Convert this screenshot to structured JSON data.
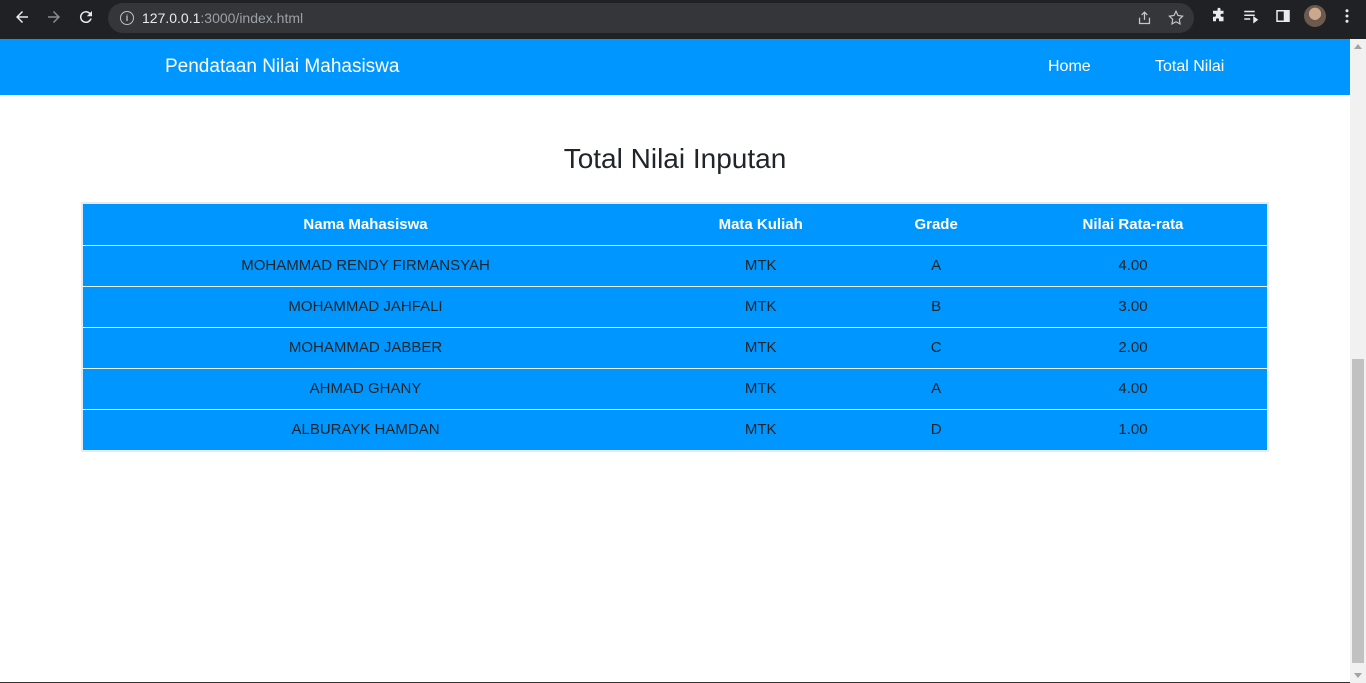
{
  "browser": {
    "url_host": "127.0.0.1",
    "url_path": ":3000/index.html"
  },
  "navbar": {
    "brand": "Pendataan Nilai Mahasiswa",
    "links": [
      "Home",
      "Total Nilai"
    ]
  },
  "main": {
    "title": "Total Nilai Inputan",
    "table": {
      "headers": [
        "Nama Mahasiswa",
        "Mata Kuliah",
        "Grade",
        "Nilai Rata-rata"
      ],
      "rows": [
        [
          "MOHAMMAD RENDY FIRMANSYAH",
          "MTK",
          "A",
          "4.00"
        ],
        [
          "MOHAMMAD JAHFALI",
          "MTK",
          "B",
          "3.00"
        ],
        [
          "MOHAMMAD JABBER",
          "MTK",
          "C",
          "2.00"
        ],
        [
          "AHMAD GHANY",
          "MTK",
          "A",
          "4.00"
        ],
        [
          "ALBURAYK HAMDAN",
          "MTK",
          "D",
          "1.00"
        ]
      ]
    }
  },
  "colors": {
    "brand_blue": "#0096ff",
    "chrome_dark": "#202124",
    "text_dark": "#212529"
  },
  "icons": {
    "back": "arrow-left-icon",
    "forward": "arrow-right-icon",
    "reload": "reload-icon",
    "info": "info-icon",
    "share": "share-icon",
    "bookmark": "star-icon",
    "extensions": "puzzle-icon",
    "reading_list": "reading-list-icon",
    "side_panel": "side-panel-icon",
    "profile": "avatar",
    "menu": "kebab-menu-icon"
  }
}
